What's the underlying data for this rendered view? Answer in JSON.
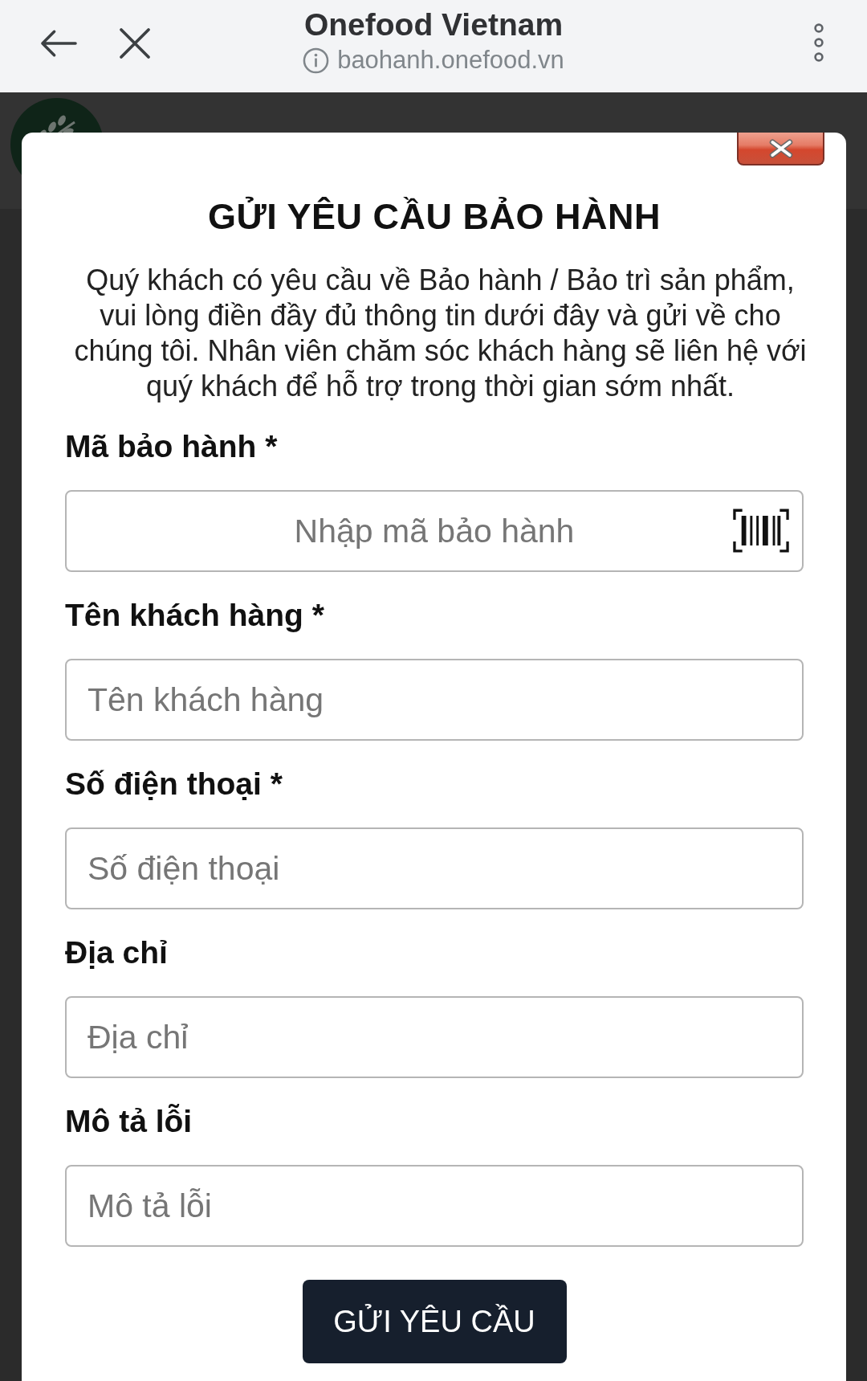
{
  "browser_bar": {
    "title": "Onefood Vietnam",
    "url": "baohanh.onefood.vn"
  },
  "modal": {
    "title": "GỬI YÊU CẦU BẢO HÀNH",
    "description": "Quý khách có yêu cầu về Bảo hành / Bảo trì sản phẩm, vui lòng điền đầy đủ thông tin dưới đây và gửi về cho chúng tôi. Nhân viên chăm sóc khách hàng sẽ liên hệ với quý khách để hỗ trợ trong thời gian sớm nhất.",
    "fields": [
      {
        "kind": "scan",
        "label": "Mã bảo hành *",
        "placeholder": "Nhập mã bảo hành"
      },
      {
        "kind": "text",
        "label": "Tên khách hàng *",
        "placeholder": "Tên khách hàng"
      },
      {
        "kind": "text",
        "label": "Số điện thoại *",
        "placeholder": "Số điện thoại"
      },
      {
        "kind": "text",
        "label": "Địa chỉ",
        "placeholder": "Địa chỉ"
      },
      {
        "kind": "text",
        "label": "Mô tả lỗi",
        "placeholder": "Mô tả lỗi"
      }
    ],
    "submit_button": "GỬI YÊU CẦU"
  }
}
